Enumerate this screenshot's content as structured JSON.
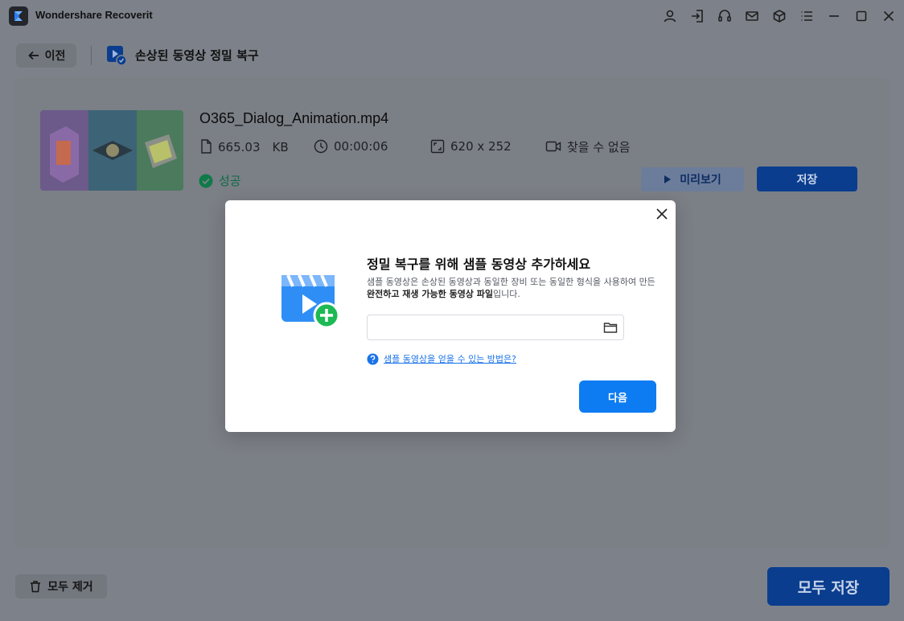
{
  "app": {
    "title": "Wondershare Recoverit"
  },
  "titlebar": {
    "icons": [
      "user-icon",
      "sign-in-icon",
      "headset-icon",
      "mail-icon",
      "cube-icon",
      "menu-icon",
      "minimize-icon",
      "maximize-icon",
      "close-icon"
    ]
  },
  "header": {
    "back_label": "이전",
    "feature_title": "손상된 동영상 정밀 복구"
  },
  "file": {
    "name": "O365_Dialog_Animation.mp4",
    "size": "665.03　KB",
    "duration": "00:00:06",
    "resolution": "620 x 252",
    "codec": "찾을 수 없음",
    "status": "성공",
    "preview_label": "미리보기",
    "save_label": "저장"
  },
  "footer": {
    "remove_all_label": "모두 제거",
    "save_all_label": "모두 저장"
  },
  "dialog": {
    "title": "정밀 복구를 위해 샘플 동영상 추가하세요",
    "desc_part1": "샘플 동영상은 손상된 동영상과 동일한 장비 또는 동일한 형식을 사용하여 만든 ",
    "desc_bold": "완전하고 재생 가능한 동영상 파일",
    "desc_part2": "입니다.",
    "input_value": "",
    "input_placeholder": "",
    "help_link": "샘플 동영상을 얻을 수 있는 방법은?",
    "next_label": "다음"
  },
  "colors": {
    "accent": "#0d7cf2",
    "success": "#1aa260",
    "overlay_bg": "#7d828a"
  }
}
